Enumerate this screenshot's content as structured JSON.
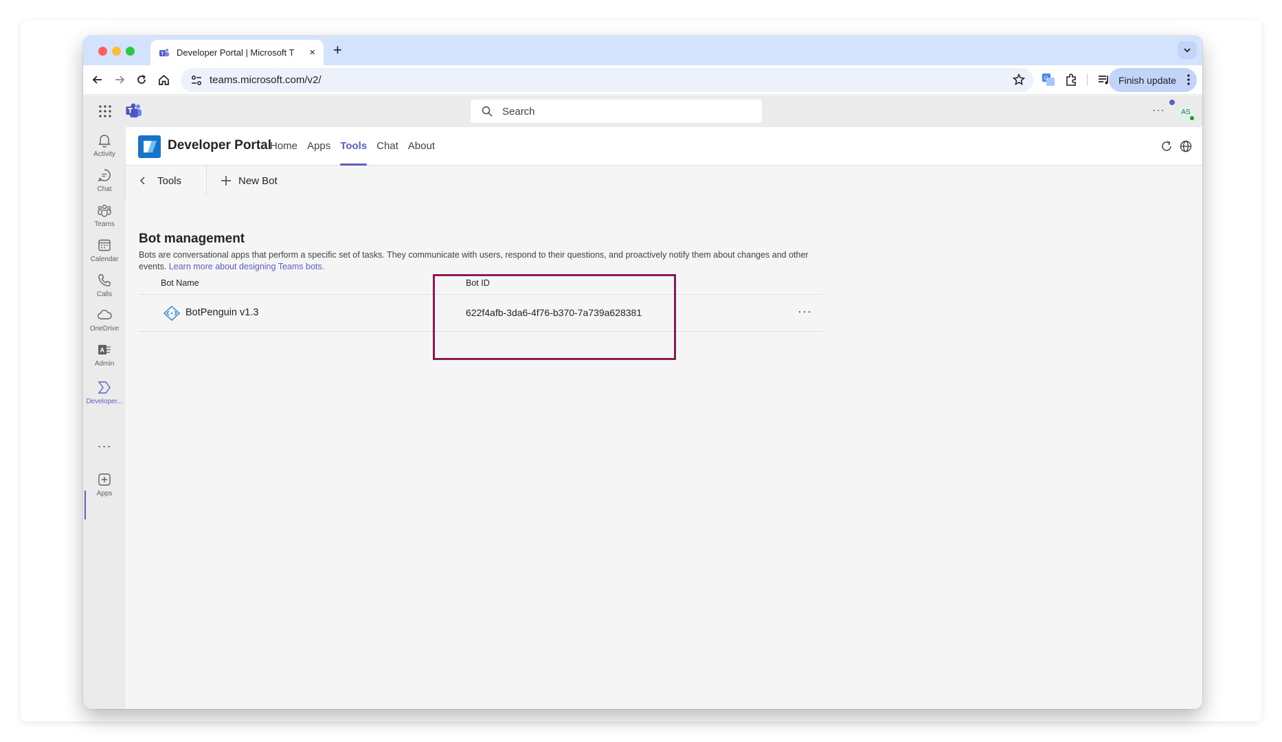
{
  "browser": {
    "tab_title": "Developer Portal | Microsoft T",
    "tab_close": "×",
    "new_tab": "+",
    "url": "teams.microsoft.com/v2/",
    "finish_update_label": "Finish update"
  },
  "teams": {
    "search_placeholder": "Search",
    "header_more": "···",
    "avatar_initials": "AS",
    "rail": [
      {
        "label": "Activity",
        "icon": "bell-icon"
      },
      {
        "label": "Chat",
        "icon": "chat-icon"
      },
      {
        "label": "Teams",
        "icon": "teams-icon"
      },
      {
        "label": "Calendar",
        "icon": "calendar-icon"
      },
      {
        "label": "Calls",
        "icon": "phone-icon"
      },
      {
        "label": "OneDrive",
        "icon": "cloud-icon"
      },
      {
        "label": "Admin",
        "icon": "admin-icon"
      },
      {
        "label": "Developer...",
        "icon": "developer-portal-icon",
        "active": true
      },
      {
        "label": "Apps",
        "icon": "add-app-icon"
      }
    ],
    "rail_more": "···"
  },
  "app": {
    "title": "Developer Portal",
    "nav": [
      {
        "label": "Home"
      },
      {
        "label": "Apps"
      },
      {
        "label": "Tools",
        "active": true
      },
      {
        "label": "Chat"
      },
      {
        "label": "About"
      }
    ],
    "accent_color": "#5b5fc7"
  },
  "command_bar": {
    "back_label": "Tools",
    "new_bot_label": "New Bot"
  },
  "page": {
    "title": "Bot management",
    "description": "Bots are conversational apps that perform a specific set of tasks. They communicate with users, respond to their questions, and proactively notify them about changes and other events.",
    "learn_more_link": "Learn more about designing Teams bots.",
    "table": {
      "columns": [
        "Bot Name",
        "Bot ID"
      ],
      "rows": [
        {
          "name": "BotPenguin v1.3",
          "id": "622f4afb-3da6-4f76-b370-7a739a628381",
          "more": "···"
        }
      ]
    },
    "highlight_color": "#8a1a4f"
  }
}
